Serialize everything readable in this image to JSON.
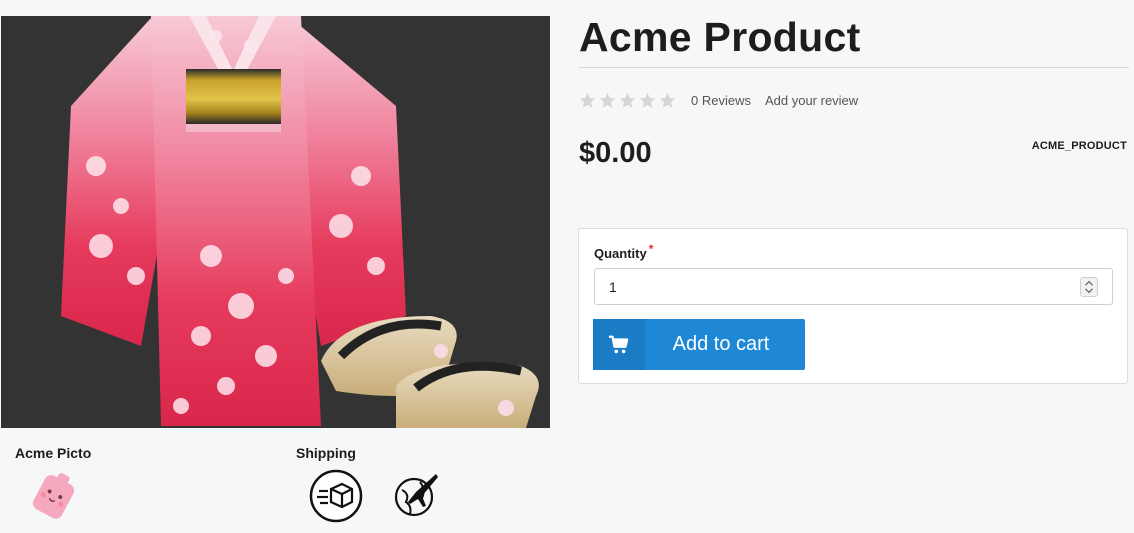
{
  "product": {
    "title": "Acme Product",
    "rating": 0,
    "rating_max": 5,
    "reviews_text": "0 Reviews",
    "add_review_text": "Add your review",
    "price": "$0.00",
    "sku": "ACME_PRODUCT"
  },
  "form": {
    "quantity_label": "Quantity",
    "required_mark": "*",
    "quantity_value": "1",
    "add_to_cart": "Add to cart"
  },
  "attributes": {
    "picto_label": "Acme Picto",
    "shipping_label": "Shipping"
  },
  "icons": {
    "main_image": "kimono-with-sandals-image",
    "picto": "pink-tag-picto",
    "shipping_1": "box-delivery-icon",
    "shipping_2": "plane-globe-icon",
    "cart": "cart-icon",
    "star": "star-icon"
  },
  "colors": {
    "accent": "#1e88d6",
    "star_empty": "#d6d6d6",
    "required": "#e02b27",
    "image_bg": "#333333",
    "kimono_pink": "#e8355b"
  }
}
